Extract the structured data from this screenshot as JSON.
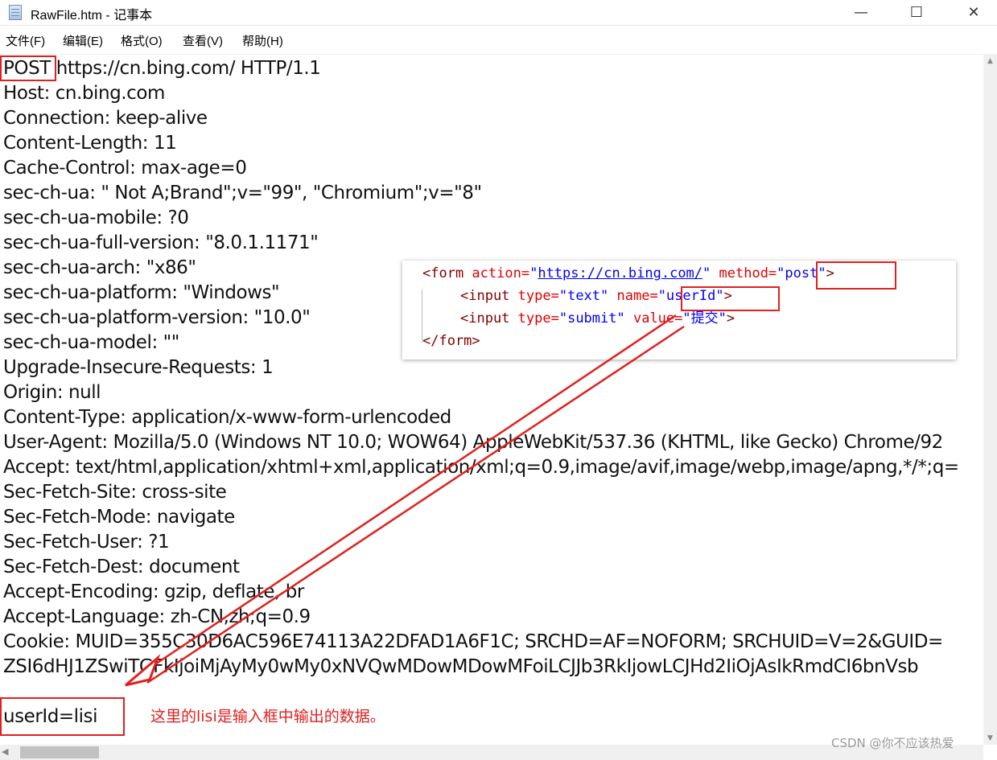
{
  "window": {
    "title": "RawFile.htm - 记事本",
    "minimize_glyph": "—",
    "maximize_glyph": "☐",
    "close_glyph": "✕"
  },
  "menu": {
    "file": "文件(F)",
    "edit": "编辑(E)",
    "format": "格式(O)",
    "view": "查看(V)",
    "help": "帮助(H)"
  },
  "editor": {
    "method": "POST",
    "request_line_rest": " https://cn.bing.com/ HTTP/1.1",
    "lines": [
      "Host: cn.bing.com",
      "Connection: keep-alive",
      "Content-Length: 11",
      "Cache-Control: max-age=0",
      "sec-ch-ua: \" Not A;Brand\";v=\"99\", \"Chromium\";v=\"8\"",
      "sec-ch-ua-mobile: ?0",
      "sec-ch-ua-full-version: \"8.0.1.1171\"",
      "sec-ch-ua-arch: \"x86\"",
      "sec-ch-ua-platform: \"Windows\"",
      "sec-ch-ua-platform-version: \"10.0\"",
      "sec-ch-ua-model: \"\"",
      "Upgrade-Insecure-Requests: 1",
      "Origin: null",
      "Content-Type: application/x-www-form-urlencoded",
      "User-Agent: Mozilla/5.0 (Windows NT 10.0; WOW64) AppleWebKit/537.36 (KHTML, like Gecko) Chrome/92",
      "Accept: text/html,application/xhtml+xml,application/xml;q=0.9,image/avif,image/webp,image/apng,*/*;q=",
      "Sec-Fetch-Site: cross-site",
      "Sec-Fetch-Mode: navigate",
      "Sec-Fetch-User: ?1",
      "Sec-Fetch-Dest: document",
      "Accept-Encoding: gzip, deflate, br",
      "Accept-Language: zh-CN,zh;q=0.9",
      "Cookie: MUID=355C30D6AC596E74113A22DFAD1A6F1C; SRCHD=AF=NOFORM; SRCHUID=V=2&GUID=",
      "ZSI6dHJ1ZSwiTGFkIjoiMjAyMy0wMy0xNVQwMDowMDowMFoiLCJJb3RkIjowLCJHd2IiOjAsIkRmdCI6bnVsb"
    ],
    "body": "userId=lisi"
  },
  "inset": {
    "form_open": "<form",
    "action_attr": " action=",
    "action_value_open": "\"",
    "action_url": "https://cn.bing.com/",
    "action_value_close": "\"",
    "method_attr": " method=",
    "method_value": "\"post\"",
    "form_open_end": ">",
    "input_open": "<input",
    "type_attr": " type=",
    "type_text_value": "\"text\"",
    "name_attr": " name=",
    "name_value": "\"userId\"",
    "input_end": ">",
    "input2_open": "<input",
    "type2_attr": " type=",
    "type_submit_value": "\"submit\"",
    "value_attr": " value=",
    "value_value": "\"提交\"",
    "input2_end": ">",
    "form_close": "</form>"
  },
  "annotation": "这里的lisi是输入框中输出的数据。",
  "watermark": "CSDN @你不应该热爱",
  "colors": {
    "highlight": "#e02020",
    "tag": "#800000",
    "attribute": "#e00000",
    "value": "#0000ff"
  }
}
